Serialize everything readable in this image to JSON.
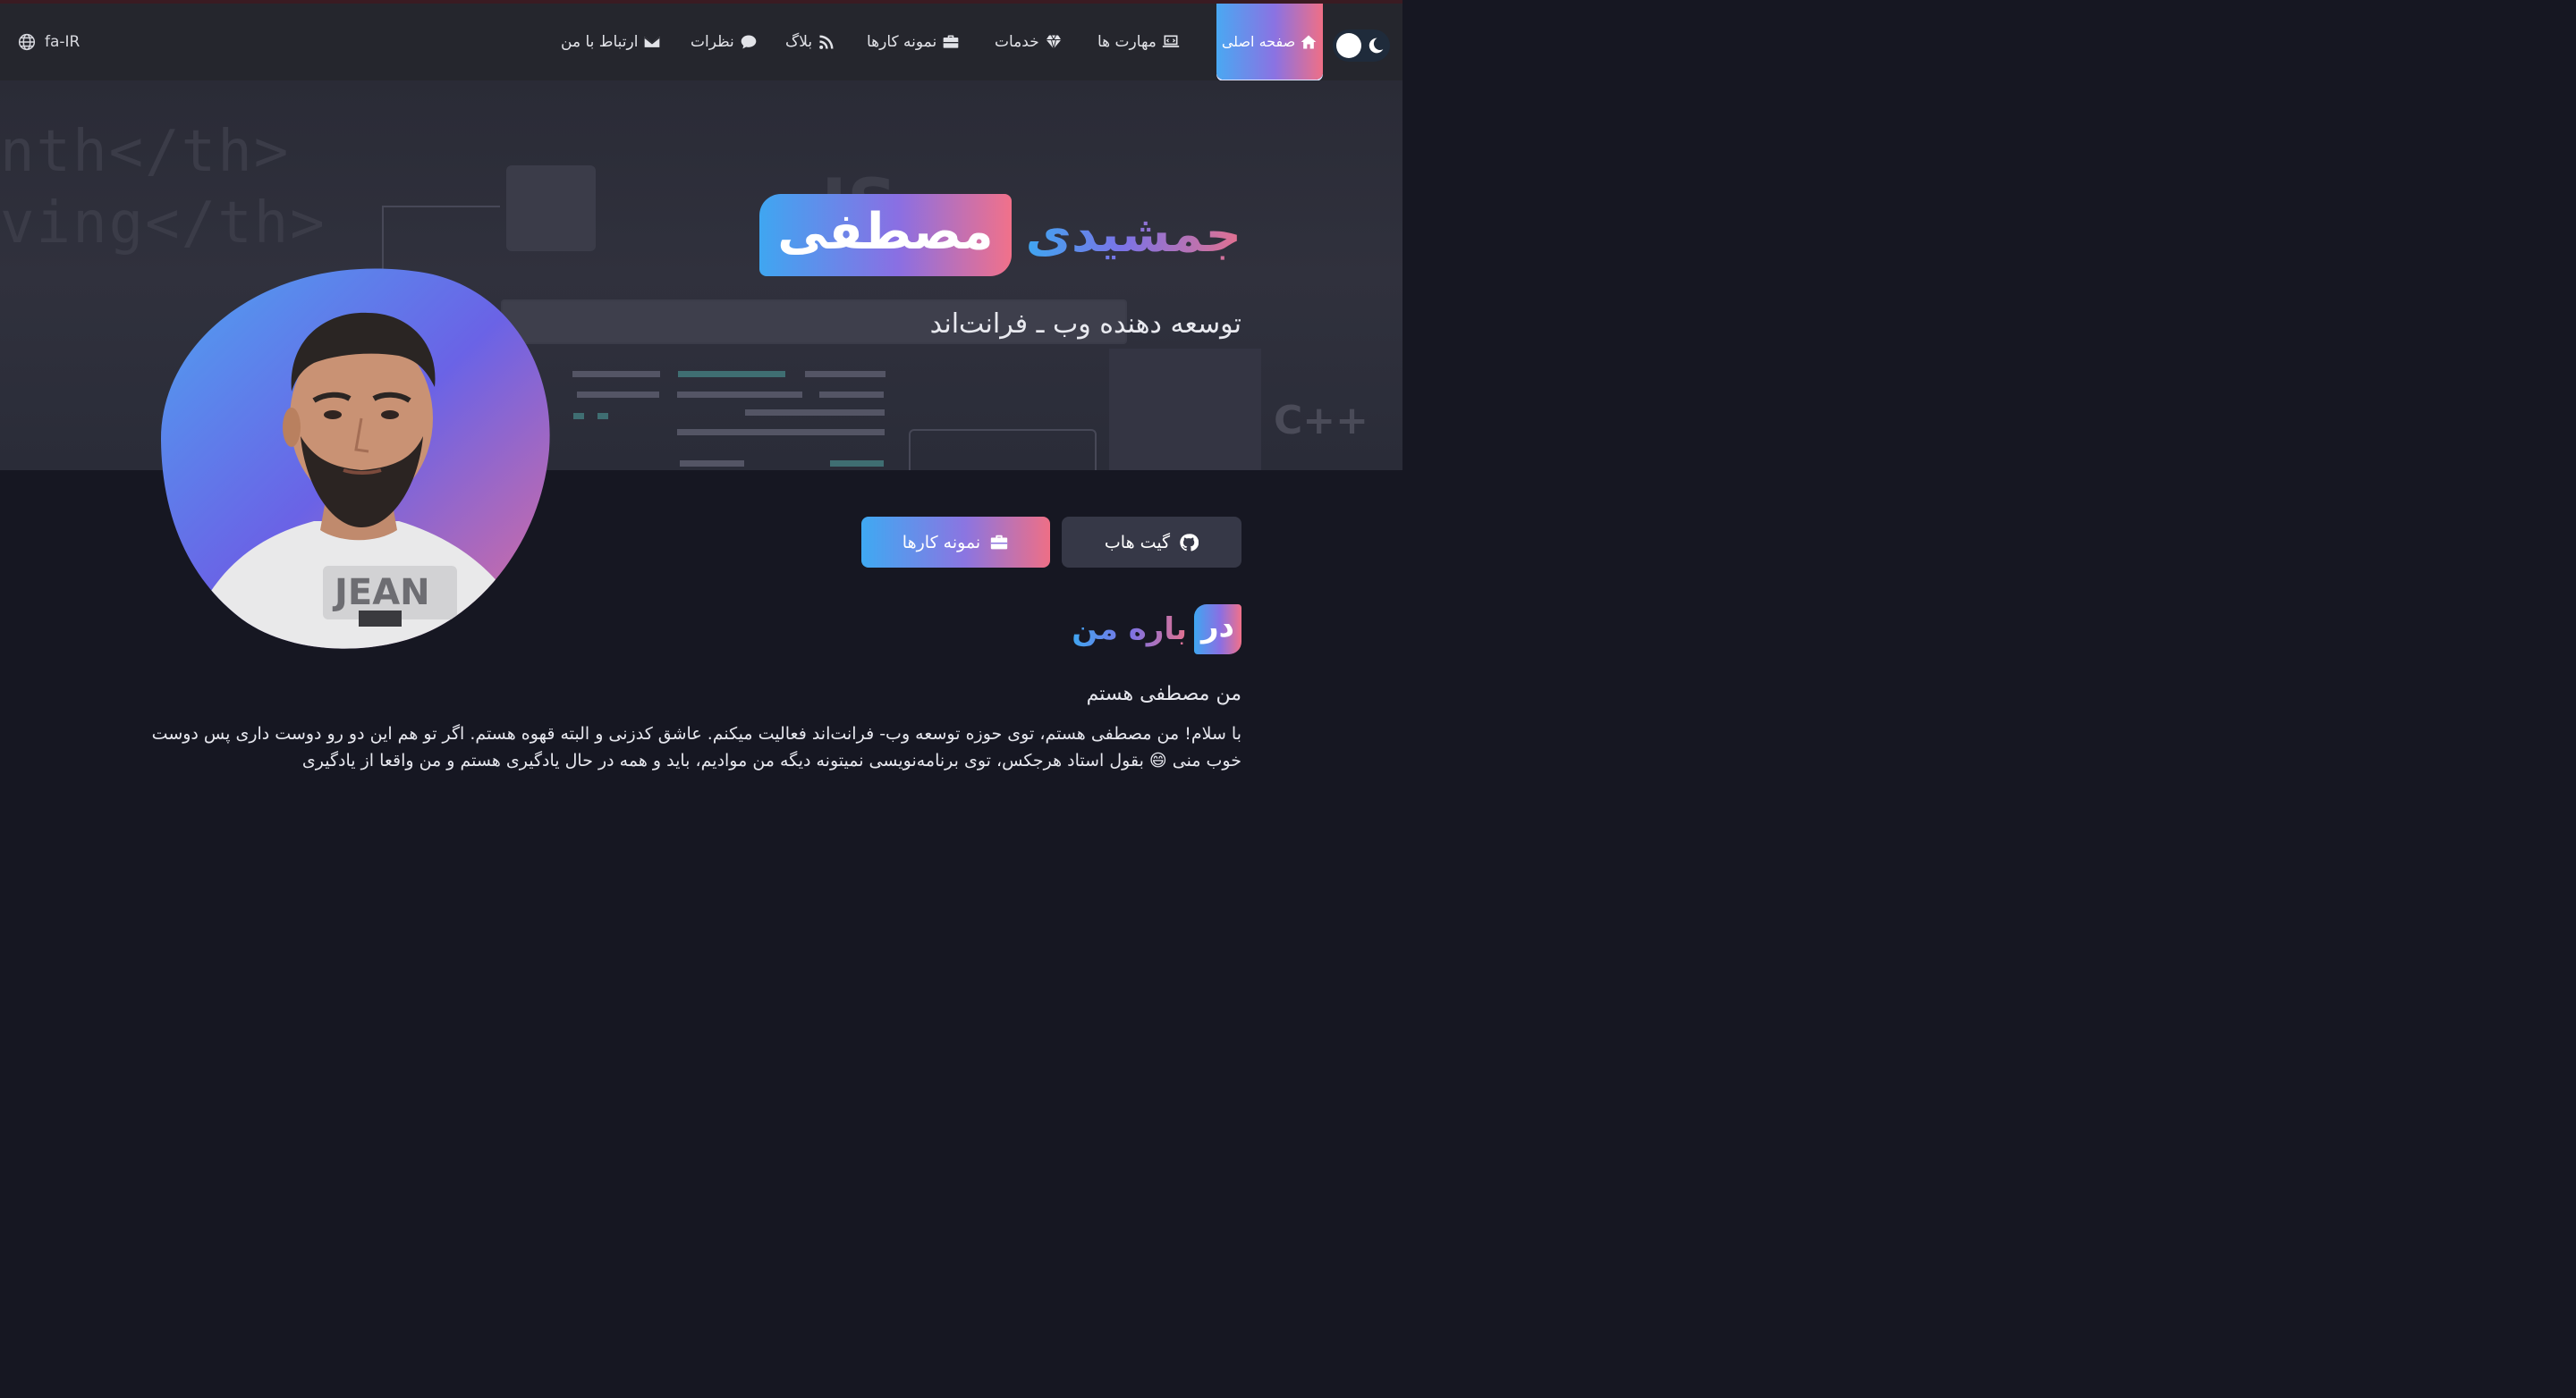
{
  "nav": {
    "lang_label": "fa-IR",
    "items": [
      {
        "label": "صفحه اصلی",
        "icon": "home-icon"
      },
      {
        "label": "مهارت ها",
        "icon": "laptop-code-icon"
      },
      {
        "label": "خدمات",
        "icon": "gem-icon"
      },
      {
        "label": "نمونه کارها",
        "icon": "briefcase-icon"
      },
      {
        "label": "بلاگ",
        "icon": "rss-icon"
      },
      {
        "label": "نظرات",
        "icon": "comment-icon"
      },
      {
        "label": "ارتباط با من",
        "icon": "envelope-icon"
      }
    ],
    "theme_toggle_icon": "moon-icon"
  },
  "hero": {
    "first_name": "مصطفی",
    "last_name": "جمشیدی",
    "job_title": "توسعه دهنده وب ـ فرانت‌اند",
    "bg_code": [
      "nth</th>",
      "ving</th>"
    ],
    "bg_js": "JS",
    "bg_cpp": "C++"
  },
  "buttons": {
    "github_label": "گیت هاب",
    "github_icon": "github-icon",
    "portfolio_label": "نمونه کارها",
    "portfolio_icon": "briefcase-icon"
  },
  "about": {
    "heading_part1": "در",
    "heading_part2": "باره من",
    "subtitle": "من مصطفی هستم",
    "text": "با سلام! من مصطفی هستم، توی حوزه توسعه وب- فرانت‌اند فعالیت میکنم. عاشق کدزنی و البته قهوه هستم. اگر تو هم این دو رو دوست داری پس دوست خوب منی 😄 بقول استاد هرجکس، توی برنامه‌نویسی نمیتونه دیگه من موادیم، باید و همه در حال یادگیری هستم و من واقعا از یادگیری"
  },
  "colors": {
    "accent_blue": "#3fa6f1",
    "accent_purple": "#8a6fe3",
    "accent_pink": "#f1718a",
    "navbar_bg": "#25262d",
    "page_bg": "#161722"
  }
}
